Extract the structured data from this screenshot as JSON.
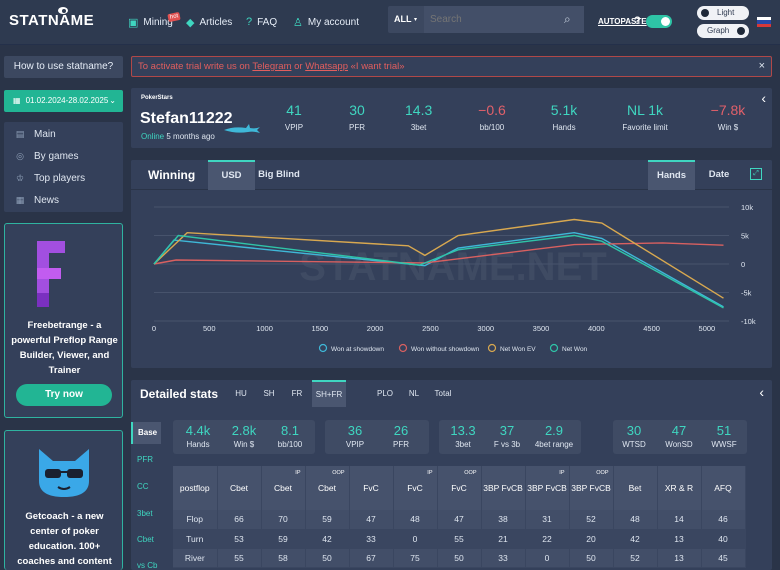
{
  "brand": {
    "logo": "STATNAME"
  },
  "nav": [
    {
      "label": "Mining",
      "icon": "briefcase-icon",
      "badge": "hot"
    },
    {
      "label": "Articles",
      "icon": "gem-icon"
    },
    {
      "label": "FAQ",
      "icon": "help-icon"
    },
    {
      "label": "My account",
      "icon": "user-icon"
    }
  ],
  "search": {
    "scope": "ALL",
    "placeholder": "Search"
  },
  "autopaste": {
    "label": "AUTOPASTE",
    "help": "?",
    "enabled": true
  },
  "theme": {
    "light": "Light",
    "graph": "Graph"
  },
  "sidebar": {
    "howto": "How to use statname?",
    "date_range": "01.02.2024-28.02.2025",
    "menu": [
      {
        "label": "Main",
        "icon": "grid-icon"
      },
      {
        "label": "By games",
        "icon": "gamepad-icon"
      },
      {
        "label": "Top players",
        "icon": "trophy-icon"
      },
      {
        "label": "News",
        "icon": "news-icon"
      }
    ],
    "promo1": {
      "text": "Freebetrange - a powerful Preflop Range Builder, Viewer, and Trainer",
      "button": "Try now"
    },
    "promo2": {
      "text": "Getcoach - a new center of poker education. 100+ coaches and content"
    }
  },
  "notice": {
    "prefix": "To activate trial write us on ",
    "link1": "Telegram",
    "mid": " or ",
    "link2": "Whatsapp",
    "suffix": " «I want trial»",
    "close": "×"
  },
  "profile": {
    "room": "PokerStars",
    "name": "Stefan11222",
    "status": "Online",
    "last_seen": "5 months ago",
    "stats": [
      {
        "value": "41",
        "label": "VPIP",
        "neg": false
      },
      {
        "value": "30",
        "label": "PFR",
        "neg": false
      },
      {
        "value": "14.3",
        "label": "3bet",
        "neg": false
      },
      {
        "value": "−0.6",
        "label": "bb/100",
        "neg": true
      },
      {
        "value": "5.1k",
        "label": "Hands",
        "neg": false
      },
      {
        "value": "NL 1k",
        "label": "Favorite limit",
        "neg": false
      },
      {
        "value": "−7.8k",
        "label": "Win $",
        "neg": true
      }
    ]
  },
  "chart_header": {
    "title": "Winning",
    "tabs": [
      "USD",
      "Big Blind"
    ],
    "axis_tabs": [
      "Hands",
      "Date"
    ]
  },
  "chart_data": {
    "type": "line",
    "x_ticks": [
      "0",
      "500",
      "1000",
      "1500",
      "2000",
      "2500",
      "3000",
      "3500",
      "4000",
      "4500",
      "5000"
    ],
    "y_ticks": [
      "10k",
      "5k",
      "0",
      "-5k",
      "-10k"
    ],
    "xlim": [
      0,
      5200
    ],
    "ylim": [
      -10000,
      10000
    ],
    "watermark": "STATNAME.NET",
    "series": [
      {
        "name": "Won at showdown",
        "color": "#3fb8d8",
        "points": [
          [
            0,
            0
          ],
          [
            180,
            4200
          ],
          [
            2450,
            -300
          ],
          [
            2750,
            2800
          ],
          [
            3800,
            5500
          ],
          [
            4050,
            4500
          ],
          [
            5150,
            -7500
          ]
        ]
      },
      {
        "name": "Won without showdown",
        "color": "#d86060",
        "points": [
          [
            0,
            0
          ],
          [
            200,
            700
          ],
          [
            2450,
            200
          ],
          [
            3800,
            3400
          ],
          [
            4600,
            3700
          ],
          [
            5150,
            3300
          ]
        ]
      },
      {
        "name": "Net Won EV",
        "color": "#d8a850",
        "points": [
          [
            0,
            0
          ],
          [
            300,
            5500
          ],
          [
            2300,
            3200
          ],
          [
            2450,
            1500
          ],
          [
            2750,
            5000
          ],
          [
            3800,
            7800
          ],
          [
            4050,
            7200
          ],
          [
            5150,
            -6000
          ]
        ]
      },
      {
        "name": "Net Won",
        "color": "#2fc4a8",
        "points": [
          [
            0,
            0
          ],
          [
            220,
            5000
          ],
          [
            2400,
            -200
          ],
          [
            2750,
            2500
          ],
          [
            3800,
            5000
          ],
          [
            4050,
            4000
          ],
          [
            5150,
            -7700
          ]
        ]
      }
    ]
  },
  "detailed": {
    "title": "Detailed stats",
    "tabs": [
      "HU",
      "SH",
      "FR",
      "SH+FR",
      "PLO",
      "NL",
      "Total"
    ],
    "side_tabs": [
      "Base",
      "PFR",
      "CC",
      "3bet",
      "Cbet",
      "vs Cb"
    ],
    "groups": [
      [
        {
          "value": "4.4k",
          "label": "Hands"
        },
        {
          "value": "2.8k",
          "label": "Win $"
        },
        {
          "value": "8.1",
          "label": "bb/100"
        }
      ],
      [
        {
          "value": "36",
          "label": "VPIP"
        },
        {
          "value": "26",
          "label": "PFR"
        }
      ],
      [
        {
          "value": "13.3",
          "label": "3bet"
        },
        {
          "value": "37",
          "label": "F vs 3b"
        },
        {
          "value": "2.9",
          "label": "4bet range"
        }
      ],
      [
        {
          "value": "30",
          "label": "WTSD"
        },
        {
          "value": "47",
          "label": "WonSD"
        },
        {
          "value": "51",
          "label": "WWSF"
        }
      ]
    ],
    "table": {
      "headers": [
        {
          "label": "postflop",
          "sup": ""
        },
        {
          "label": "Cbet",
          "sup": ""
        },
        {
          "label": "Cbet",
          "sup": "IP"
        },
        {
          "label": "Cbet",
          "sup": "OOP"
        },
        {
          "label": "FvC",
          "sup": ""
        },
        {
          "label": "FvC",
          "sup": "IP"
        },
        {
          "label": "FvC",
          "sup": "OOP"
        },
        {
          "label": "3BP FvCB",
          "sup": ""
        },
        {
          "label": "3BP FvCB",
          "sup": "IP"
        },
        {
          "label": "3BP FvCB",
          "sup": "OOP"
        },
        {
          "label": "Bet",
          "sup": ""
        },
        {
          "label": "XR & R",
          "sup": ""
        },
        {
          "label": "AFQ",
          "sup": ""
        }
      ],
      "rows": [
        [
          "Flop",
          "66",
          "70",
          "59",
          "47",
          "48",
          "47",
          "38",
          "31",
          "52",
          "48",
          "14",
          "46"
        ],
        [
          "Turn",
          "53",
          "59",
          "42",
          "33",
          "0",
          "55",
          "21",
          "22",
          "20",
          "42",
          "13",
          "40"
        ],
        [
          "River",
          "55",
          "58",
          "50",
          "67",
          "75",
          "50",
          "33",
          "0",
          "50",
          "52",
          "13",
          "45"
        ]
      ]
    }
  }
}
